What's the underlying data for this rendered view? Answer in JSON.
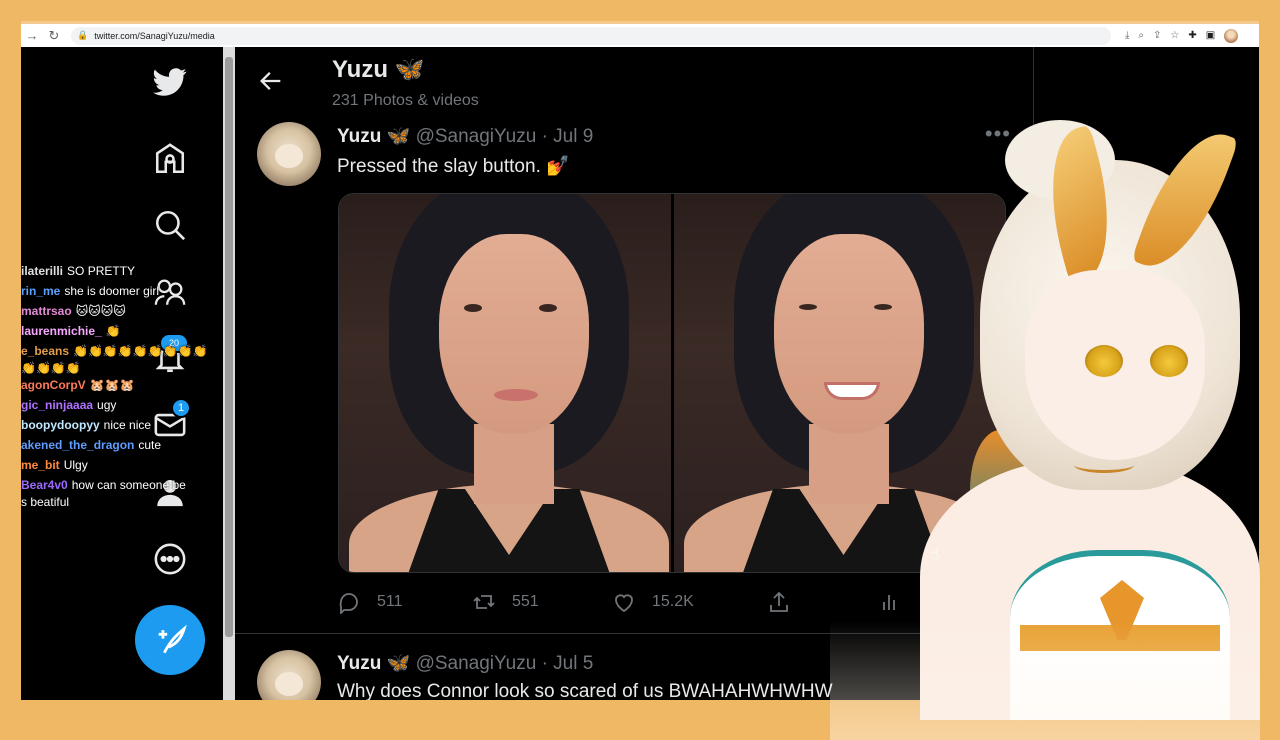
{
  "browser": {
    "url": "twitter.com/SanagiYuzu/media",
    "icons": [
      "back-icon",
      "reload-icon",
      "lock-icon",
      "install-icon",
      "zoom-icon",
      "share-icon",
      "star-icon",
      "extensions-icon",
      "sidebar-icon",
      "profile-avatar"
    ]
  },
  "nav": {
    "items": [
      "twitter-logo",
      "home-icon",
      "explore-icon",
      "communities-icon",
      "notifications-icon",
      "messages-icon",
      "profile-icon",
      "more-icon"
    ],
    "messages_badge": "1"
  },
  "chat": [
    {
      "user": "ilaterilli",
      "color": "#e0e0e0",
      "text": "SO PRETTY"
    },
    {
      "user": "rin_me",
      "color": "#5aa0ff",
      "text": "she is doomer girl"
    },
    {
      "user": "mattrsao",
      "color": "#e58bd8",
      "text": "🐱🐱🐱🐱"
    },
    {
      "user": "laurenmichie_",
      "color": "#f6a7ff",
      "text": "👏"
    },
    {
      "user": "e_beans",
      "color": "#e39c4b",
      "text": "👏👏👏👏👏👏👏👏👏"
    },
    {
      "user": "",
      "color": "#ffffff",
      "text": "👏👏👏👏"
    },
    {
      "user": "agonCorpV",
      "color": "#ff7a59",
      "text": "🐹🐹🐹"
    },
    {
      "user": "gic_ninjaaaa",
      "color": "#b071ff",
      "text": "ugy"
    },
    {
      "user": "boopydoopyy",
      "color": "#bfe8ff",
      "text": "nice nice"
    },
    {
      "user": "akened_the_dragon",
      "color": "#5e9cff",
      "text": "cute"
    },
    {
      "user": "me_bit",
      "color": "#ff8a3d",
      "text": "Ulgy"
    },
    {
      "user": "Bear4v0",
      "color": "#9b6bff",
      "text": "how can someone be"
    },
    {
      "user": "",
      "color": "#ffffff",
      "text": "s beatiful"
    }
  ],
  "header": {
    "name": "Yuzu 🦋",
    "subtitle": "231 Photos & videos"
  },
  "tweets": [
    {
      "name": "Yuzu 🦋",
      "handle": "@SanagiYuzu",
      "date": "· Jul 9",
      "text": "Pressed the slay button. 💅",
      "replies": "511",
      "retweets": "551",
      "likes": "15.2K"
    },
    {
      "name": "Yuzu 🦋",
      "handle": "@SanagiYuzu",
      "date": "· Jul 5",
      "text": "Why does Connor look so scared of us BWAHAHWHWHW"
    }
  ],
  "colors": {
    "accent": "#1d9bf0",
    "frame": "#eeb865",
    "background": "#000000"
  }
}
